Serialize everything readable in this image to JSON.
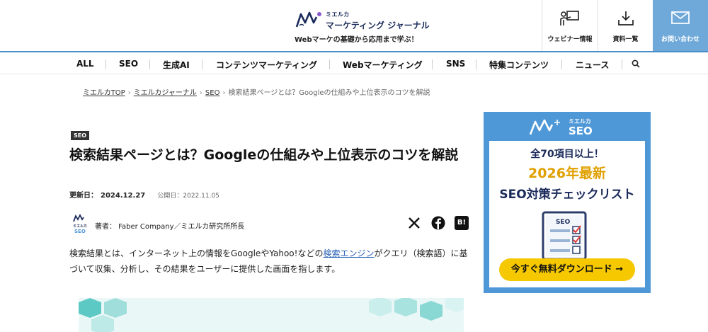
{
  "header": {
    "logo_small": "ミエルカ",
    "logo_main": "マーケティング ジャーナル",
    "tagline": "Webマーケの基礎から応用まで学ぶ！",
    "buttons": [
      {
        "label": "ウェビナー情報",
        "icon": "presenter-icon"
      },
      {
        "label": "資料一覧",
        "icon": "download-icon"
      },
      {
        "label": "お問い合わせ",
        "icon": "mail-icon"
      }
    ],
    "accent": "#6fa9d9"
  },
  "nav": {
    "items": [
      "ALL",
      "SEO",
      "生成AI",
      "コンテンツマーケティング",
      "Webマーケティング",
      "SNS",
      "特集コンテンツ",
      "ニュース"
    ],
    "search_icon": "search-icon"
  },
  "breadcrumb": {
    "items": [
      "ミエルカTOP",
      "ミエルカジャーナル",
      "SEO"
    ],
    "current": "検索結果ページとは？Googleの仕組みや上位表示のコツを解説"
  },
  "article": {
    "tag": "SEO",
    "title": "検索結果ページとは？Googleの仕組みや上位表示のコツを解説",
    "updated_label": "更新日：",
    "updated_date": "2024.12.27",
    "published_label": "公開日：",
    "published_date": "2022.11.05",
    "author_logo_text": "ミエルカ SEO",
    "author": "著者： Faber Company／ミエルカ研究所所長",
    "share_icons": [
      "x-icon",
      "facebook-icon",
      "hatena-bookmark-icon"
    ],
    "share_labels": [
      "B!"
    ],
    "intro_before": "検索結果とは、インターネット上の情報をGoogleやYahoo!などの",
    "intro_link": "検索エンジン",
    "intro_after": "がクエリ（検索語）に基づいて収集、分析し、その結果をユーザーに提供した画面を指します。"
  },
  "banner": {
    "logo_small": "ミエルカ",
    "logo_seo": "SEO",
    "line1": "全70項目以上！",
    "line2": "2026年最新",
    "line3": "SEO対策チェックリスト",
    "doc_label": "SEO",
    "cta": "今すぐ無料ダウンロード →",
    "bg": "#4f98d8",
    "cta_color": "#f5c800"
  }
}
